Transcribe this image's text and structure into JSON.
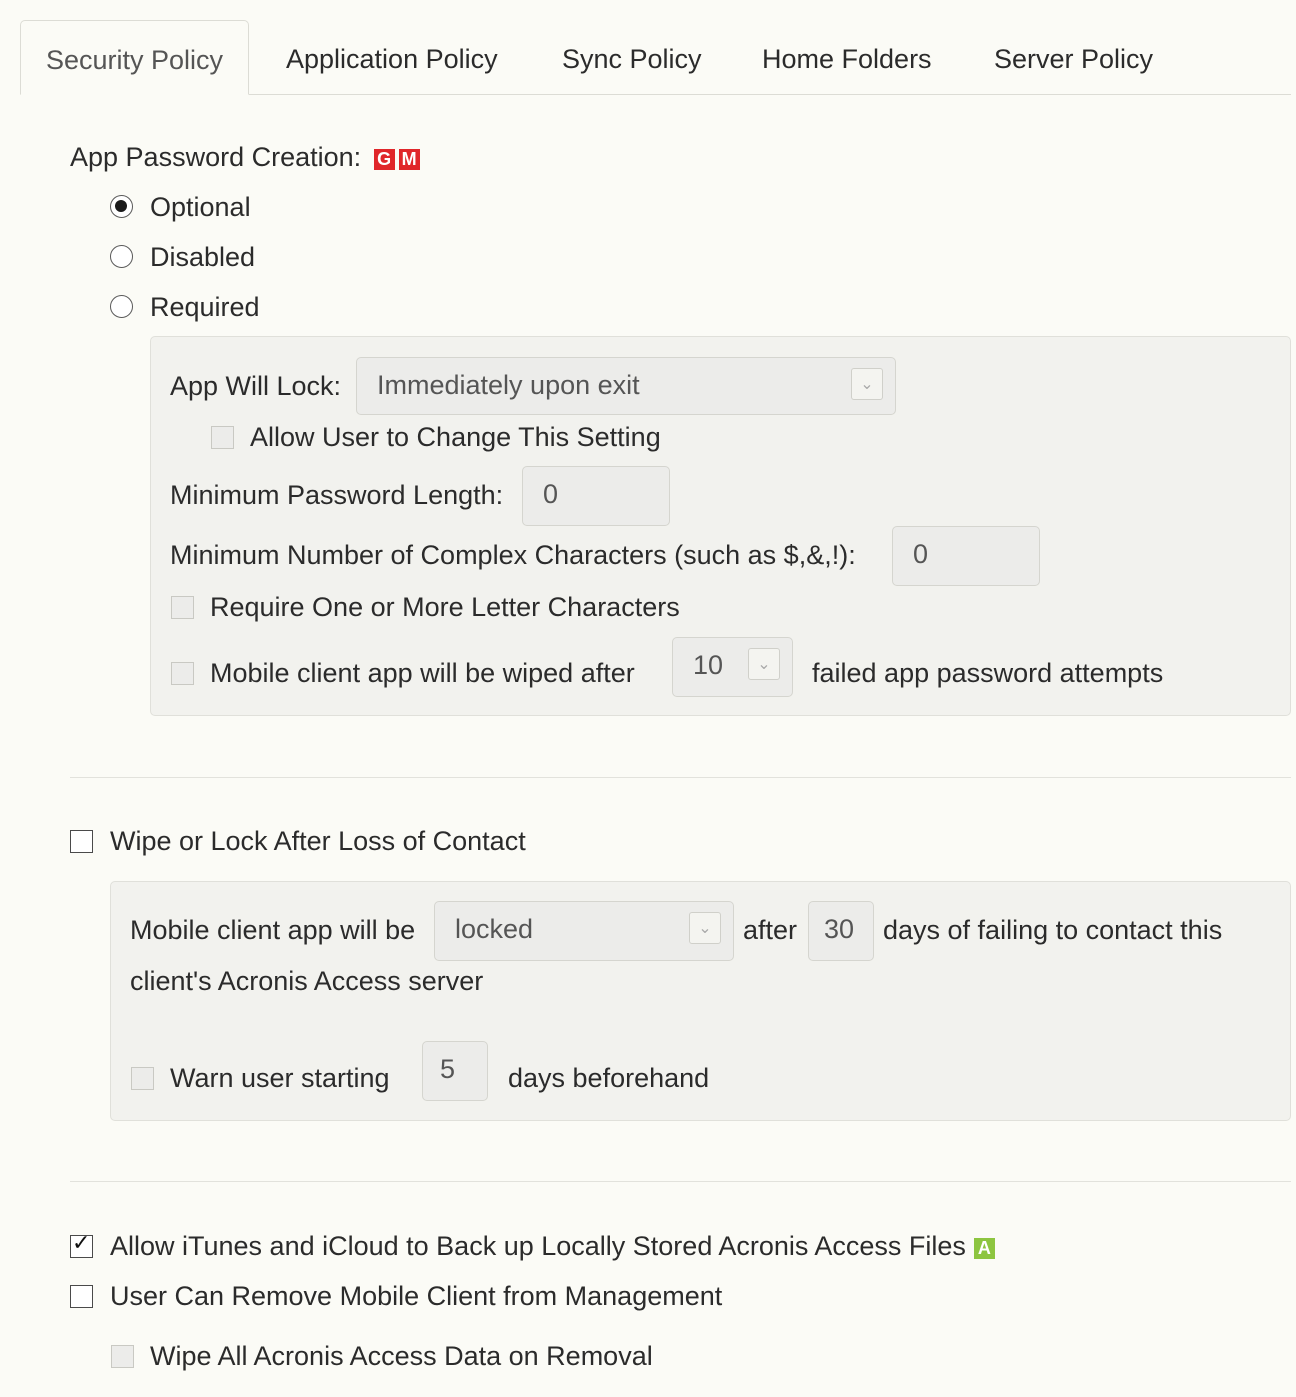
{
  "tabs": [
    "Security Policy",
    "Application Policy",
    "Sync Policy",
    "Home Folders",
    "Server Policy"
  ],
  "app_password": {
    "heading": "App Password Creation:",
    "badges": [
      "G",
      "M"
    ],
    "options": [
      "Optional",
      "Disabled",
      "Required"
    ],
    "selected": "Optional"
  },
  "required_panel": {
    "lock_label": "App Will Lock:",
    "lock_value": "Immediately upon exit",
    "allow_change": "Allow User to Change This Setting",
    "min_length_label": "Minimum Password Length:",
    "min_length_value": "0",
    "min_complex_label": "Minimum Number of Complex Characters (such as $,&,!):",
    "min_complex_value": "0",
    "require_letter": "Require One or More Letter Characters",
    "wipe_prefix": "Mobile client app will be wiped after",
    "wipe_attempts": "10",
    "wipe_suffix": "failed app password attempts"
  },
  "loss_of_contact": {
    "label": "Wipe or Lock After Loss of Contact",
    "checked": false,
    "prefix": "Mobile client app will be",
    "action": "locked",
    "after": "after",
    "days": "30",
    "suffix_line1": "days of failing to contact this",
    "suffix_line2": "client's Acronis Access server",
    "warn_prefix": "Warn user starting",
    "warn_days": "5",
    "warn_suffix": "days beforehand"
  },
  "backup": {
    "label": "Allow iTunes and iCloud to Back up Locally Stored Acronis Access Files",
    "badge": "A",
    "checked": true
  },
  "removal": {
    "label": "User Can Remove Mobile Client from Management",
    "checked": false,
    "wipe_label": "Wipe All Acronis Access Data on Removal"
  },
  "colors": {
    "badge_red": "#e0262a",
    "badge_green": "#8dc540",
    "background": "#fbfbf6"
  }
}
